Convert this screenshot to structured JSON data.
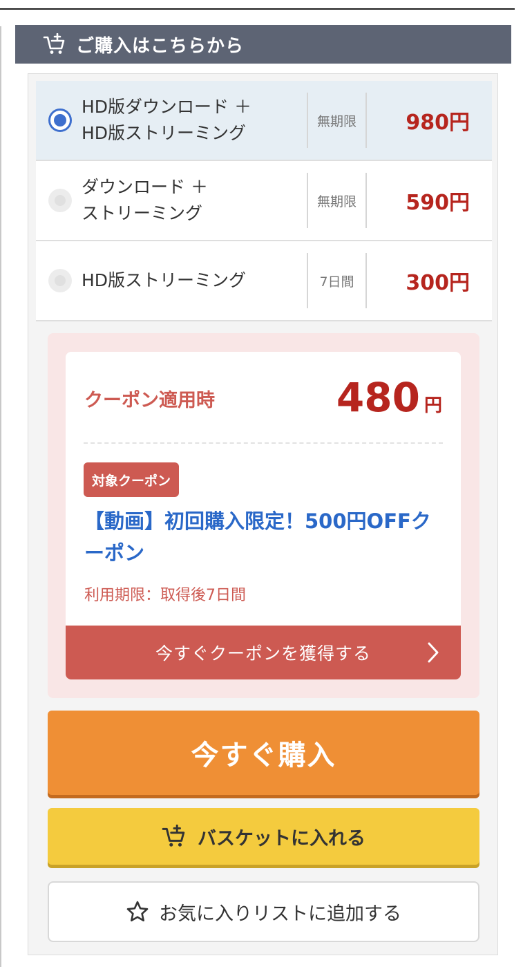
{
  "header": {
    "title": "ご購入はこちらから",
    "icon": "cart-icon"
  },
  "options": [
    {
      "label": "HD版ダウンロード ＋\nHD版ストリーミング",
      "period": "無期限",
      "price": "980円",
      "selected": true
    },
    {
      "label": "ダウンロード ＋\nストリーミング",
      "period": "無期限",
      "price": "590円",
      "selected": false
    },
    {
      "label": "HD版ストリーミング",
      "period": "7日間",
      "price": "300円",
      "selected": false
    }
  ],
  "coupon": {
    "label": "クーポン適用時",
    "price": "480",
    "unit": "円",
    "badge": "対象クーポン",
    "name": "【動画】初回購入限定！500円OFFクーポン",
    "expiry": "利用期限：取得後7日間",
    "button": "今すぐクーポンを獲得する"
  },
  "buttons": {
    "buy": "今すぐ購入",
    "basket": "バスケットに入れる",
    "favorite": "お気に入りリストに追加する"
  },
  "colors": {
    "header_bg": "#5d6474",
    "price_red": "#b6251e",
    "coupon_red": "#cd5a52",
    "coupon_blue": "#2a68c8",
    "buy_orange": "#ef8f35",
    "basket_yellow": "#f4cb3e",
    "radio_blue": "#3e6fce"
  }
}
